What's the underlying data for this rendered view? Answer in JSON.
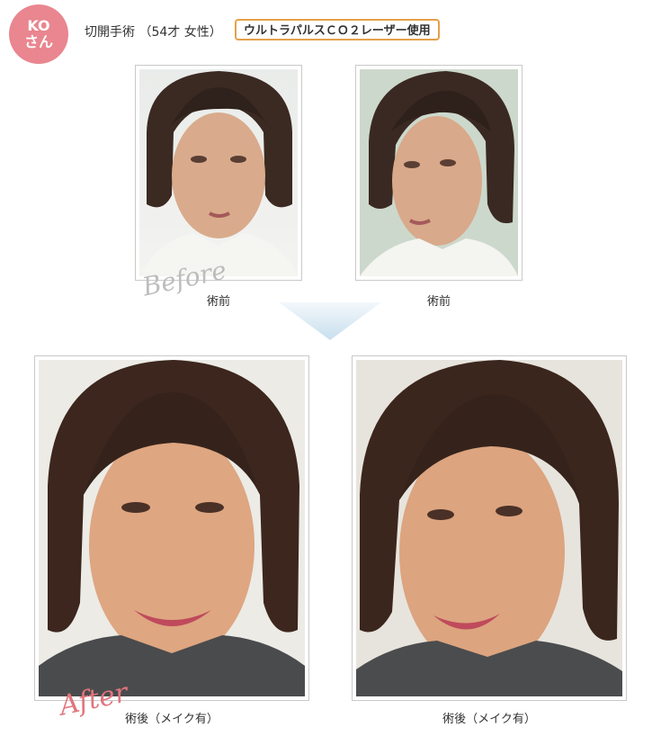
{
  "badge": {
    "line1": "KO",
    "line2": "さん"
  },
  "header": {
    "surgery": "切開手術 （54才 女性）",
    "laser": "ウルトラパルスＣＯ２レーザー使用"
  },
  "before": {
    "label_script": "Before",
    "captions": [
      "術前",
      "術前"
    ]
  },
  "after": {
    "label_script": "After",
    "captions": [
      "術後（メイク有）",
      "術後（メイク有）"
    ]
  },
  "colors": {
    "badge": "#e9868f",
    "laser_border": "#e6a04b",
    "before_script": "#bdbdbd",
    "after_script": "#e2747d",
    "arrow": "#d3e6f1"
  }
}
